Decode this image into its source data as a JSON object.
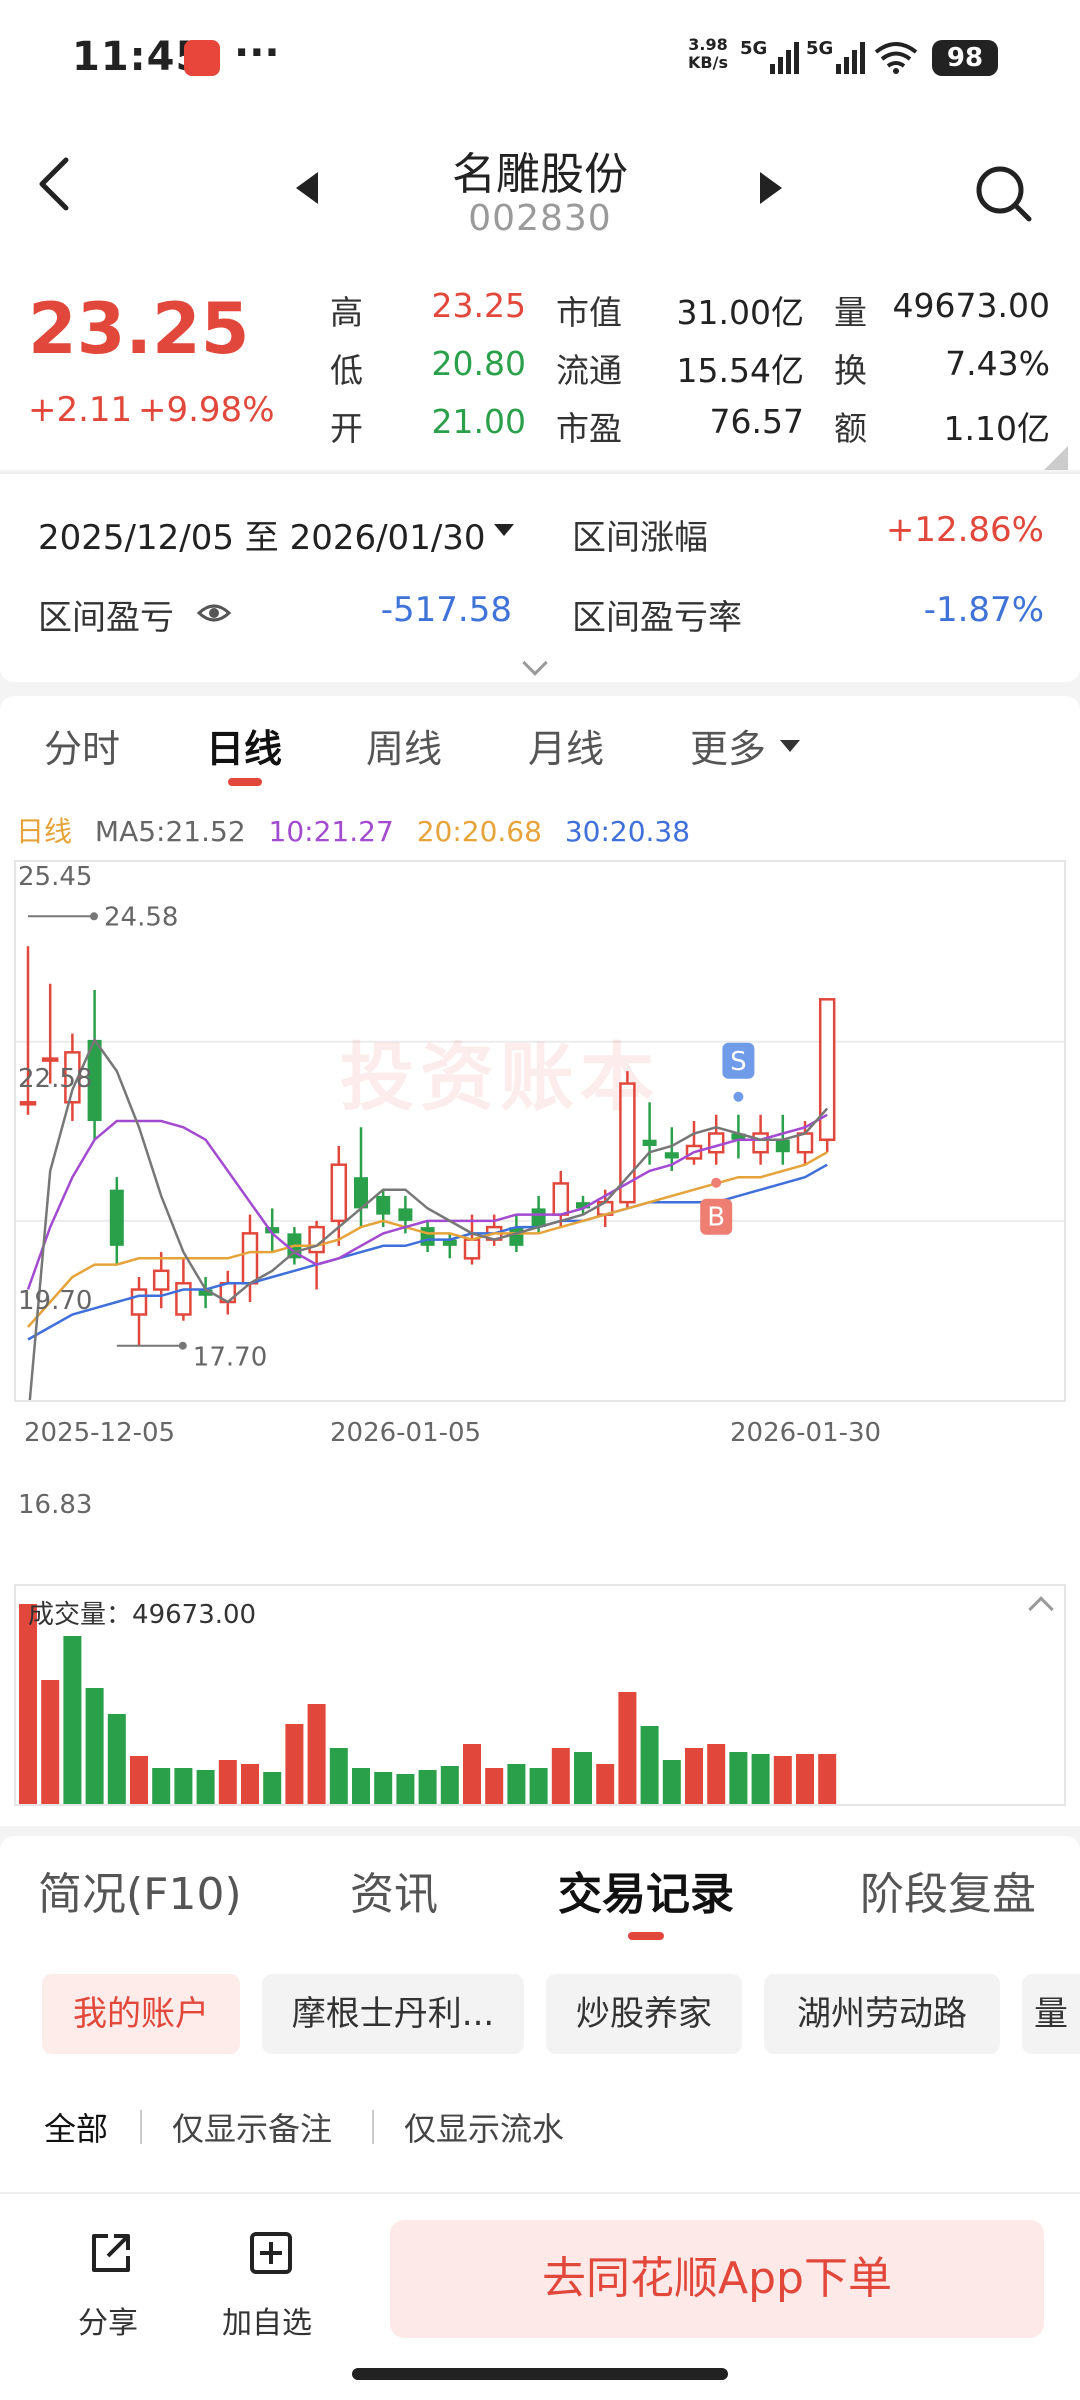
{
  "status_bar": {
    "time": "11:45",
    "menu": "···",
    "net_speed": "3.98",
    "net_unit": "KB/s",
    "sig1": "5G",
    "sig2": "5G",
    "battery": "98"
  },
  "header": {
    "stock_name": "名雕股份",
    "stock_code": "002830"
  },
  "quote": {
    "price": "23.25",
    "change": "+2.11",
    "change_pct": "+9.98%",
    "high_label": "高",
    "high": "23.25",
    "low_label": "低",
    "low": "20.80",
    "open_label": "开",
    "open": "21.00",
    "mcap_label": "市值",
    "mcap": "31.00亿",
    "float_label": "流通",
    "float": "15.54亿",
    "pe_label": "市盈",
    "pe": "76.57",
    "vol_label": "量",
    "vol": "49673.00",
    "turnover_label": "换",
    "turnover": "7.43%",
    "amount_label": "额",
    "amount": "1.10亿"
  },
  "range": {
    "date_range": "2025/12/05 至 2026/01/30",
    "gain_label": "区间涨幅",
    "gain": "+12.86%",
    "pnl_label": "区间盈亏",
    "pnl": "-517.58",
    "pnl_rate_label": "区间盈亏率",
    "pnl_rate": "-1.87%"
  },
  "chart_tabs": [
    "分时",
    "日线",
    "周线",
    "月线",
    "更多"
  ],
  "ma_legend": {
    "title": "日线",
    "ma5": "MA5:21.52",
    "ma10": "10:21.27",
    "ma20": "20:20.68",
    "ma30": "30:20.38"
  },
  "watermark": "投资账本",
  "chart_data": {
    "type": "candlestick",
    "y_ticks": [
      "25.45",
      "22.58",
      "19.70",
      "16.83"
    ],
    "ylim": [
      16.83,
      25.45
    ],
    "x_ticks": [
      "2025-12-05",
      "2026-01-05",
      "2026-01-30"
    ],
    "max_label": "24.58",
    "min_label": "17.70",
    "markers": {
      "sell": "S",
      "buy": "B",
      "sell_index": 32,
      "buy_index": 31
    },
    "colors": {
      "up": "#e2473b",
      "down": "#2aa04a",
      "ma5": "#777777",
      "ma10": "#a24bd0",
      "ma20": "#e6a33a",
      "ma30": "#3f6fd8"
    },
    "candles": [
      [
        21.6,
        23.2,
        21.4,
        24.1,
        1
      ],
      [
        22.3,
        22.9,
        21.9,
        23.5,
        1
      ],
      [
        22.4,
        21.6,
        21.3,
        22.7,
        1
      ],
      [
        22.6,
        21.3,
        21.0,
        23.4,
        0
      ],
      [
        20.2,
        19.3,
        19.0,
        20.4,
        0
      ],
      [
        18.6,
        18.2,
        17.7,
        18.8,
        1
      ],
      [
        18.9,
        18.6,
        18.3,
        19.2,
        1
      ],
      [
        18.7,
        18.2,
        18.1,
        19.1,
        1
      ],
      [
        18.6,
        18.5,
        18.3,
        18.8,
        0
      ],
      [
        18.7,
        18.4,
        18.2,
        18.9,
        1
      ],
      [
        19.5,
        18.7,
        18.4,
        19.8,
        1
      ],
      [
        19.6,
        19.5,
        19.2,
        19.9,
        0
      ],
      [
        19.5,
        19.1,
        19.0,
        19.6,
        0
      ],
      [
        19.6,
        19.2,
        18.6,
        19.7,
        1
      ],
      [
        20.6,
        19.7,
        19.3,
        20.9,
        1
      ],
      [
        20.4,
        19.9,
        19.6,
        21.2,
        0
      ],
      [
        20.1,
        19.8,
        19.6,
        20.2,
        0
      ],
      [
        19.9,
        19.7,
        19.5,
        20.1,
        0
      ],
      [
        19.6,
        19.3,
        19.2,
        19.7,
        0
      ],
      [
        19.4,
        19.3,
        19.1,
        19.5,
        0
      ],
      [
        19.4,
        19.1,
        19.0,
        19.8,
        1
      ],
      [
        19.6,
        19.4,
        19.3,
        19.8,
        1
      ],
      [
        19.6,
        19.3,
        19.2,
        19.8,
        0
      ],
      [
        19.9,
        19.6,
        19.5,
        20.1,
        0
      ],
      [
        20.3,
        19.8,
        19.6,
        20.5,
        1
      ],
      [
        20.0,
        19.9,
        19.8,
        20.1,
        0
      ],
      [
        20.0,
        19.8,
        19.6,
        20.2,
        1
      ],
      [
        21.9,
        20.0,
        19.9,
        22.1,
        1
      ],
      [
        21.0,
        20.9,
        20.6,
        21.6,
        0
      ],
      [
        20.8,
        20.7,
        20.5,
        21.2,
        0
      ],
      [
        20.9,
        20.7,
        20.6,
        21.3,
        1
      ],
      [
        21.1,
        20.8,
        20.6,
        21.4,
        1
      ],
      [
        21.1,
        21.0,
        20.7,
        21.4,
        0
      ],
      [
        21.1,
        20.8,
        20.6,
        21.4,
        1
      ],
      [
        21.0,
        20.8,
        20.6,
        21.4,
        0
      ],
      [
        21.1,
        20.8,
        20.6,
        21.3,
        1
      ],
      [
        23.25,
        21.0,
        20.8,
        23.25,
        1
      ]
    ],
    "ma": {
      "ma5": [
        16.5,
        20.5,
        21.8,
        22.6,
        22.1,
        21.2,
        20.1,
        19.2,
        18.6,
        18.4,
        18.7,
        18.9,
        19.2,
        19.3,
        19.6,
        19.9,
        20.2,
        20.2,
        19.9,
        19.7,
        19.5,
        19.4,
        19.5,
        19.6,
        19.7,
        19.8,
        20.0,
        20.4,
        20.8,
        20.9,
        21.1,
        21.2,
        21.1,
        21.0,
        21.0,
        21.1,
        21.5
      ],
      "ma10": [
        18.6,
        19.6,
        20.4,
        21.0,
        21.3,
        21.3,
        21.3,
        21.2,
        21.0,
        20.5,
        20.0,
        19.5,
        19.2,
        19.0,
        19.1,
        19.3,
        19.5,
        19.6,
        19.7,
        19.7,
        19.7,
        19.7,
        19.8,
        19.8,
        19.8,
        19.9,
        20.1,
        20.3,
        20.5,
        20.6,
        20.8,
        20.9,
        21.0,
        21.0,
        21.1,
        21.2,
        21.4
      ],
      "ma20": [
        18.0,
        18.4,
        18.8,
        19.0,
        19.0,
        19.1,
        19.1,
        19.1,
        19.1,
        19.1,
        19.2,
        19.2,
        19.3,
        19.3,
        19.4,
        19.6,
        19.7,
        19.6,
        19.5,
        19.5,
        19.4,
        19.5,
        19.5,
        19.5,
        19.6,
        19.7,
        19.8,
        19.9,
        20.0,
        20.1,
        20.2,
        20.3,
        20.4,
        20.4,
        20.5,
        20.6,
        20.8
      ],
      "ma30": [
        17.8,
        18.0,
        18.2,
        18.3,
        18.4,
        18.5,
        18.5,
        18.6,
        18.6,
        18.7,
        18.7,
        18.8,
        18.9,
        19.0,
        19.1,
        19.2,
        19.3,
        19.3,
        19.4,
        19.4,
        19.5,
        19.5,
        19.6,
        19.6,
        19.7,
        19.7,
        19.8,
        19.9,
        20.0,
        20.0,
        20.0,
        20.0,
        20.1,
        20.2,
        20.3,
        20.4,
        20.6
      ]
    },
    "volume_label": "成交量",
    "volume_value": "49673.00",
    "volume": [
      1.0,
      0.62,
      0.84,
      0.58,
      0.45,
      0.24,
      0.18,
      0.18,
      0.17,
      0.22,
      0.2,
      0.16,
      0.4,
      0.5,
      0.28,
      0.18,
      0.16,
      0.15,
      0.17,
      0.19,
      0.3,
      0.18,
      0.2,
      0.18,
      0.28,
      0.26,
      0.2,
      0.56,
      0.39,
      0.22,
      0.28,
      0.3,
      0.26,
      0.25,
      0.24,
      0.25,
      0.25
    ],
    "volume_up": [
      1,
      1,
      0,
      0,
      0,
      1,
      0,
      0,
      0,
      1,
      1,
      0,
      1,
      1,
      0,
      0,
      0,
      0,
      0,
      0,
      1,
      1,
      0,
      0,
      1,
      0,
      1,
      1,
      0,
      0,
      1,
      1,
      0,
      0,
      1,
      1,
      1
    ]
  },
  "bottom_tabs": [
    "简况(F10)",
    "资讯",
    "交易记录",
    "阶段复盘"
  ],
  "accounts": [
    "我的账户",
    "摩根士丹利...",
    "炒股养家",
    "湖州劳动路",
    "量"
  ],
  "filters": [
    "全部",
    "仅显示备注",
    "仅显示流水"
  ],
  "bottom_bar": {
    "share": "分享",
    "add_fav": "加自选",
    "order": "去同花顺App下单"
  }
}
